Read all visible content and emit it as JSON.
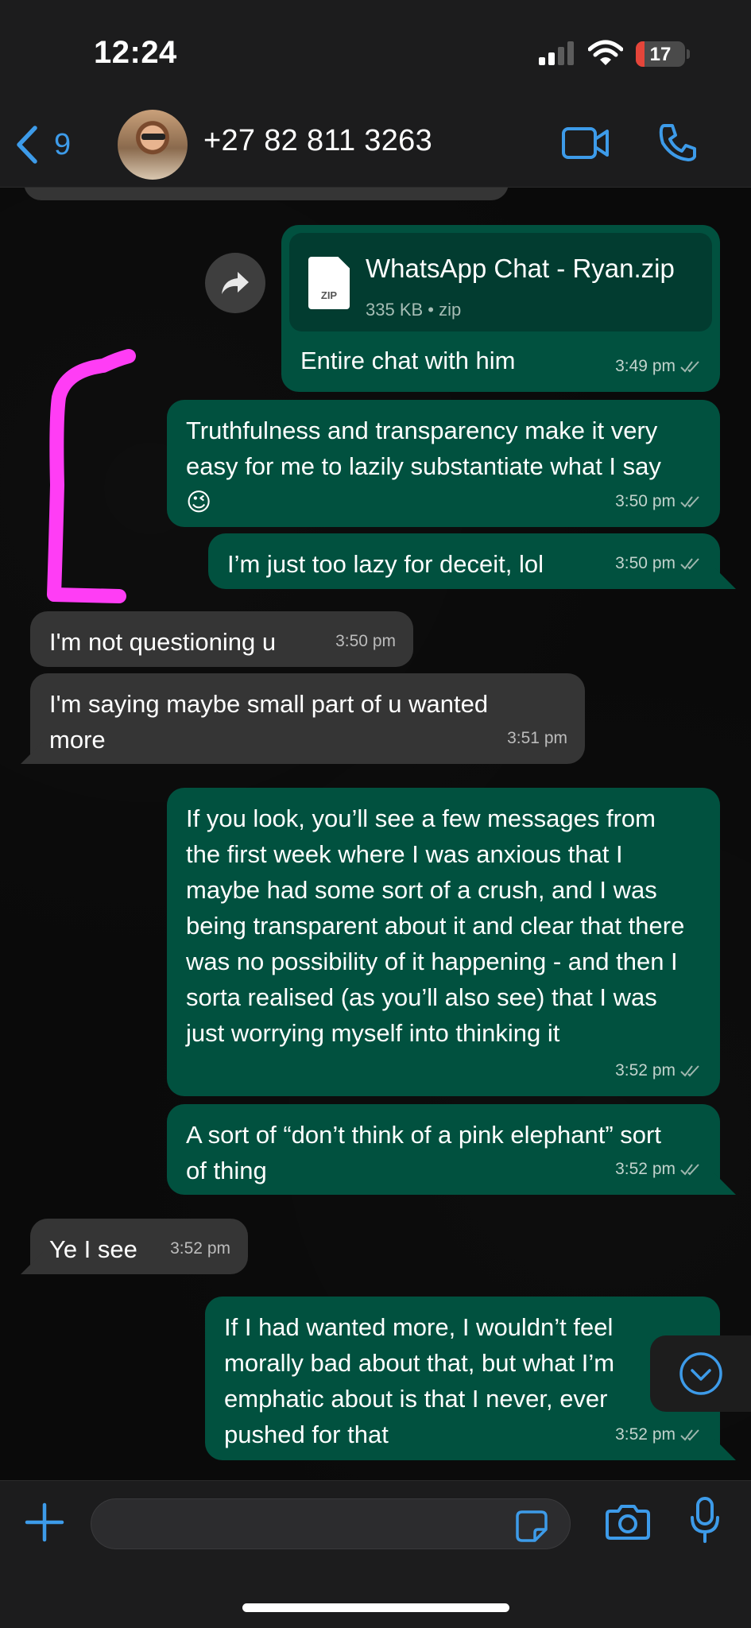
{
  "status_bar": {
    "time": "12:24",
    "battery_level": "17",
    "battery_color": "#e5453a"
  },
  "header": {
    "back_count": "9",
    "contact_name": "+27 82 811 3263",
    "icons": [
      "chevron-left-icon",
      "video-camera-icon",
      "phone-icon"
    ]
  },
  "messages": [
    {
      "direction": "out",
      "type": "file",
      "file_name": "WhatsApp Chat - Ryan.zip",
      "file_meta": "335 KB • zip",
      "file_icon_label": "ZIP",
      "caption": "Entire chat with him",
      "time": "3:49 pm"
    },
    {
      "direction": "out",
      "text": "Truthfulness and transparency make it very easy for me to lazily substantiate what I say 😉",
      "time": "3:50 pm"
    },
    {
      "direction": "out",
      "text": "I’m just too lazy for deceit, lol",
      "time": "3:50 pm"
    },
    {
      "direction": "in",
      "text": "I'm not questioning u",
      "time": "3:50 pm"
    },
    {
      "direction": "in",
      "text": "I'm saying maybe small part of u wanted more",
      "time": "3:51 pm"
    },
    {
      "direction": "out",
      "text": "If you look, you’ll see a few messages from the first week where I was anxious that I maybe had some sort of a crush, and I was being transparent about it and clear that there was no possibility of it happening - and then I sorta realised (as you’ll also see) that I was just worrying myself into thinking it",
      "time": "3:52 pm"
    },
    {
      "direction": "out",
      "text": "A sort of “don’t think of a pink elephant” sort of thing",
      "time": "3:52 pm"
    },
    {
      "direction": "in",
      "text": "Ye I see",
      "time": "3:52 pm"
    },
    {
      "direction": "out",
      "text": "If I had wanted more, I wouldn’t feel morally bad about that, but what I’m emphatic about is that I never, ever pushed for that",
      "time": "3:52 pm"
    }
  ],
  "annotation_color": "#ff3df5",
  "colors": {
    "accent": "#3d9be9",
    "outgoing_bubble": "#01513f",
    "incoming_bubble": "#353535"
  }
}
